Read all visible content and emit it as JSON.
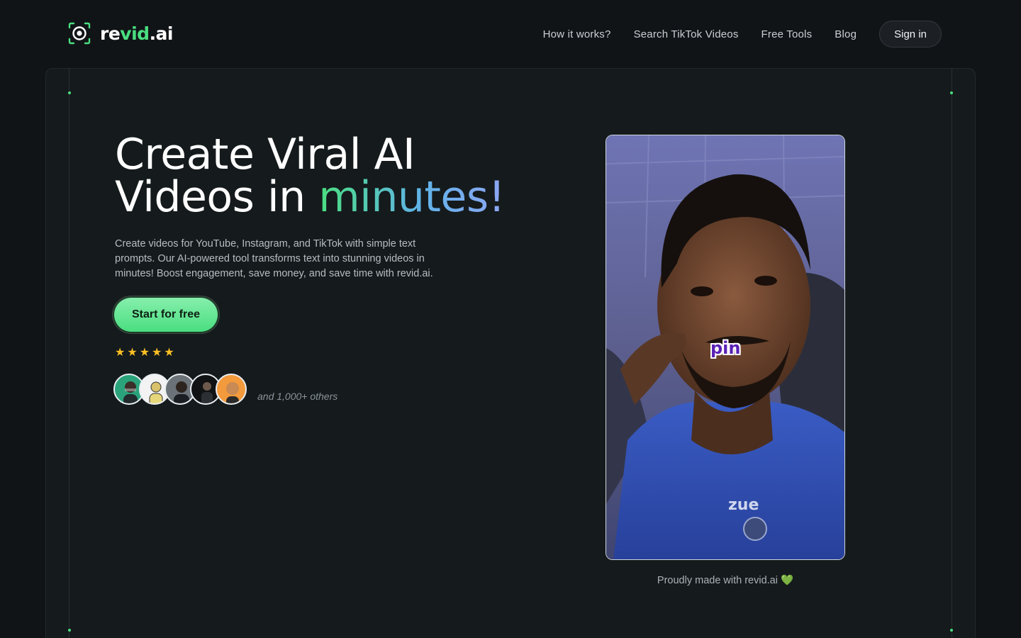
{
  "brand": {
    "name_prefix": "re",
    "name_accent": "vid",
    "name_suffix": ".ai",
    "accent_color": "#4ade80"
  },
  "nav": {
    "items": [
      "How it works?",
      "Search TikTok Videos",
      "Free Tools",
      "Blog"
    ],
    "signin_label": "Sign in"
  },
  "hero": {
    "title_line1": "Create Viral AI",
    "title_line2_plain": "Videos in ",
    "title_line2_accent": "minutes!",
    "subtitle": "Create videos for YouTube, Instagram, and TikTok with simple text prompts. Our AI-powered tool transforms text into stunning videos in minutes! Boost engagement, save money, and save time with revid.ai.",
    "cta_label": "Start for free",
    "rating_stars": 5,
    "others_label": "and 1,000+ others"
  },
  "video": {
    "caption_word": "pin",
    "shirt_text": "zue",
    "footer": "Proudly made with revid.ai 💚"
  }
}
